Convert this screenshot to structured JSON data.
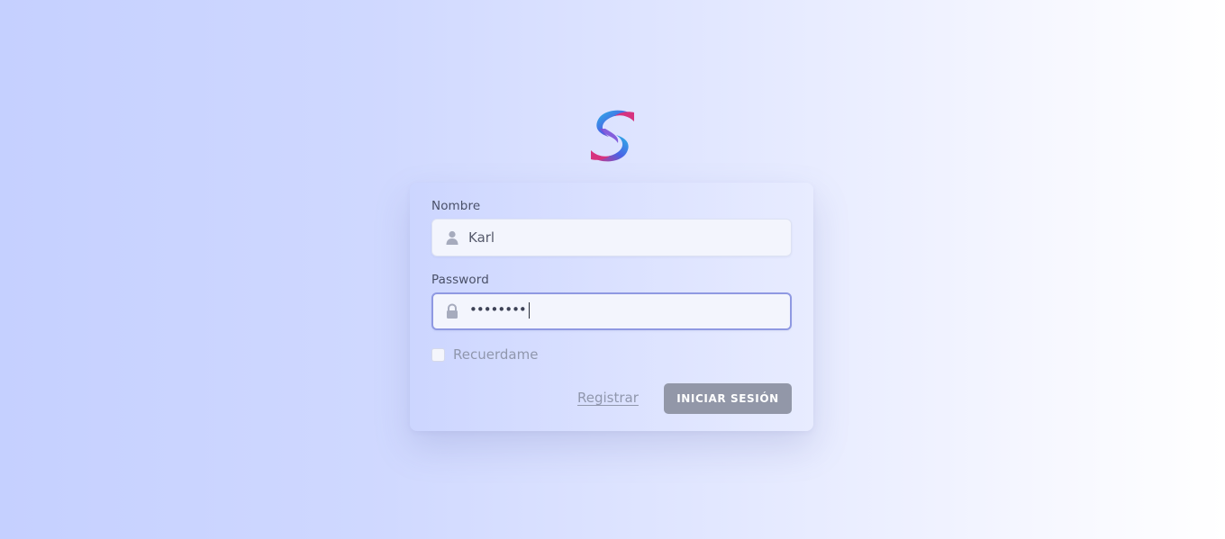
{
  "logo": {
    "name": "swirl-s-logo"
  },
  "form": {
    "nombre_label": "Nombre",
    "nombre_value": "Karl",
    "nombre_icon": "user-icon",
    "password_label": "Password",
    "password_value": "••••••••",
    "password_icon": "lock-icon",
    "remember_label": "Recuerdame",
    "remember_checked": false,
    "register_link": "Registrar",
    "login_button": "INICIAR SESIÓN"
  },
  "colors": {
    "background_start": "#c5d0ff",
    "background_end": "#ffffff",
    "button": "#9297a8",
    "focus_border": "#8f99e2",
    "logo_pink": "#d6337f",
    "logo_cyan": "#2ab6e6",
    "logo_blue": "#4a63e6"
  }
}
